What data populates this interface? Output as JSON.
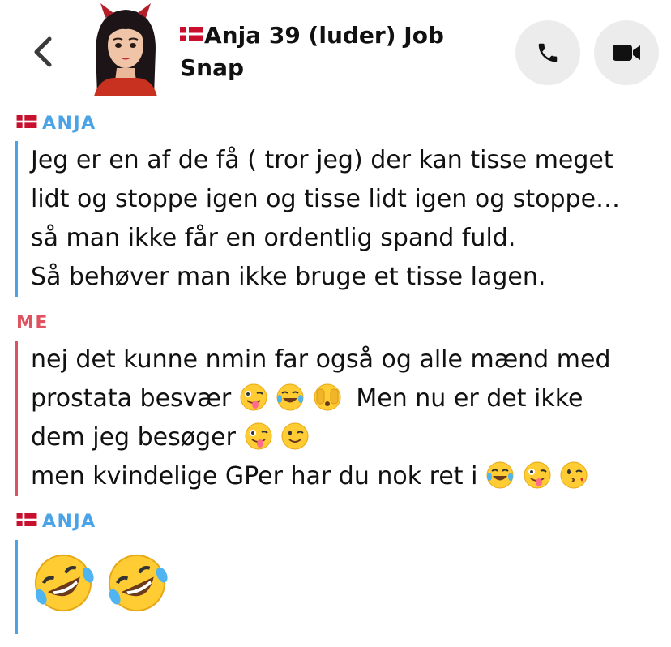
{
  "header": {
    "back_icon": "chevron-left-icon",
    "title_line1": "Anja 39 (luder) Job",
    "title_line2": "Snap",
    "call_icon": "phone-icon",
    "video_icon": "video-camera-icon"
  },
  "colors": {
    "friend_accent": "#4aa3e6",
    "me_accent": "#e0525f",
    "button_bg": "#ececec"
  },
  "messages": [
    {
      "sender": "ANJA",
      "lines": [
        "Jeg er en af de få ( tror jeg) der kan tisse meget",
        "lidt og stoppe igen og tisse lidt igen og stoppe…",
        "så man ikke får en ordentlig spand fuld.",
        "Så behøver man ikke bruge et tisse lagen."
      ]
    },
    {
      "sender": "ME",
      "lines": [
        "nej det kunne nmin far også og alle mænd med",
        "prostata besvær",
        "Men nu er det ikke",
        "dem jeg besøger",
        "men kvindelige GPer har du nok ret i"
      ],
      "emojis": [
        "zany-face",
        "tears-of-joy",
        "face-peeking",
        "zany-face",
        "winking-face",
        "tears-of-joy",
        "zany-face",
        "face-blowing-kiss"
      ]
    },
    {
      "sender": "ANJA",
      "emojis": [
        "rolling-on-floor-laughing",
        "rolling-on-floor-laughing"
      ]
    }
  ]
}
